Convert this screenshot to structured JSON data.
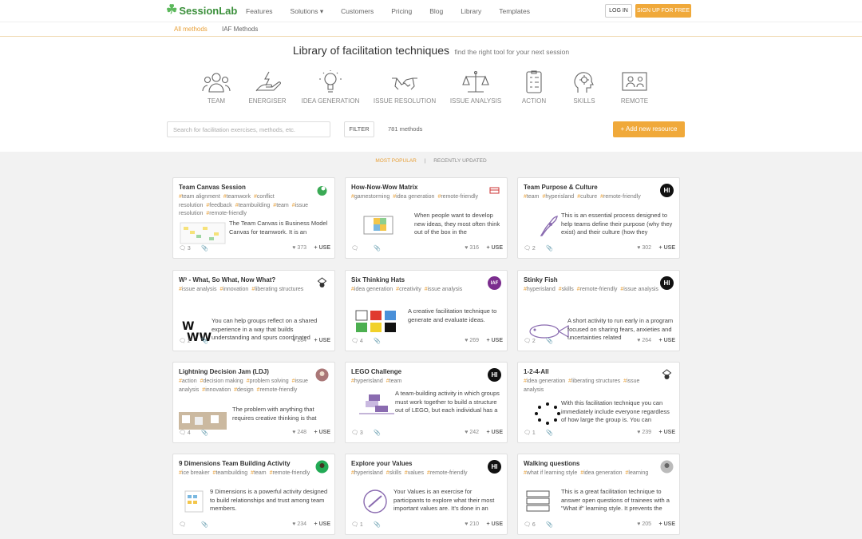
{
  "brand": {
    "name": "SessionLab",
    "accent": "#f0a93a",
    "tag_color": "#e8a13a"
  },
  "nav": {
    "items": [
      "Features",
      "Solutions ▾",
      "Customers",
      "Pricing",
      "Blog",
      "Library",
      "Templates"
    ],
    "login": "LOG IN",
    "signup": "SIGN UP FOR FREE"
  },
  "subnav": {
    "all": "All methods",
    "iaf": "IAF Methods"
  },
  "hero": {
    "title": "Library of facilitation techniques",
    "subtitle": "find the right tool for your next session"
  },
  "categories": [
    "TEAM",
    "ENERGISER",
    "IDEA GENERATION",
    "ISSUE RESOLUTION",
    "ISSUE ANALYSIS",
    "ACTION",
    "SKILLS",
    "REMOTE"
  ],
  "search": {
    "placeholder": "Search for facilitation exercises, methods, etc.",
    "filter": "FILTER",
    "count": "781 methods",
    "add": "+ Add new resource"
  },
  "sort": {
    "popular": "MOST POPULAR",
    "sep": "|",
    "recent": "RECENTLY UPDATED"
  },
  "cards": [
    {
      "title": "Team Canvas Session",
      "badge": "",
      "tags": [
        "team alignment",
        "teamwork",
        "conflict resolution",
        "feedback",
        "teambuilding",
        "team",
        "issue resolution",
        "remote-friendly"
      ],
      "desc": "The Team Canvas is Business Model Canvas for teamwork. It is an",
      "comments": "3",
      "likes": "373",
      "use": "USE"
    },
    {
      "title": "How-Now-Wow Matrix",
      "badge": "",
      "tags": [
        "gamestorming",
        "idea generation",
        "remote-friendly"
      ],
      "desc": "When people want to develop new ideas, they most often think out of the box in the",
      "comments": "",
      "likes": "316",
      "use": "USE"
    },
    {
      "title": "Team Purpose & Culture",
      "badge": "HI",
      "tags": [
        "team",
        "hyperisland",
        "culture",
        "remote-friendly"
      ],
      "desc": "This is an essential process designed to help teams define their purpose (why they exist) and their culture (how they",
      "comments": "2",
      "likes": "302",
      "use": "USE"
    },
    {
      "title": "W³ - What, So What, Now What?",
      "badge": "",
      "tags": [
        "issue analysis",
        "innovation",
        "liberating structures"
      ],
      "desc": "You can help groups reflect on a shared experience in a way that builds understanding and spurs coordinated",
      "comments": "2",
      "likes": "284",
      "use": "USE"
    },
    {
      "title": "Six Thinking Hats",
      "badge": "IAF",
      "tags": [
        "idea generation",
        "creativity",
        "issue analysis"
      ],
      "desc": "A creative facilitation technique to generate and evaluate ideas.",
      "comments": "4",
      "likes": "269",
      "use": "USE"
    },
    {
      "title": "Stinky Fish",
      "badge": "HI",
      "tags": [
        "hyperisland",
        "skills",
        "remote-friendly",
        "issue analysis"
      ],
      "desc": "A short activity to run early in a program focused on sharing fears, anxieties and uncertainties related",
      "comments": "2",
      "likes": "264",
      "use": "USE"
    },
    {
      "title": "Lightning Decision Jam (LDJ)",
      "badge": "",
      "tags": [
        "action",
        "decision making",
        "problem solving",
        "issue analysis",
        "innovation",
        "design",
        "remote-friendly"
      ],
      "desc": "The problem with anything that requires creative thinking is that",
      "comments": "4",
      "likes": "248",
      "use": "USE"
    },
    {
      "title": "LEGO Challenge",
      "badge": "HI",
      "tags": [
        "hyperisland",
        "team"
      ],
      "desc": "A team-building activity in which groups must work together to build a structure out of LEGO, but each individual has a secret \"assignment\"",
      "comments": "3",
      "likes": "242",
      "use": "USE"
    },
    {
      "title": "1-2-4-All",
      "badge": "",
      "tags": [
        "idea generation",
        "liberating structures",
        "issue analysis"
      ],
      "desc": "With this facilitation technique you can immediately include everyone regardless of how large the group is. You can",
      "comments": "1",
      "likes": "239",
      "use": "USE"
    },
    {
      "title": "9 Dimensions Team Building Activity",
      "badge": "",
      "tags": [
        "ice breaker",
        "teambuilding",
        "team",
        "remote-friendly"
      ],
      "desc": "9 Dimensions is a powerful activity designed to build relationships and trust among team members.",
      "comments": "",
      "likes": "234",
      "use": "USE"
    },
    {
      "title": "Explore your Values",
      "badge": "HI",
      "tags": [
        "hyperisland",
        "skills",
        "values",
        "remote-friendly"
      ],
      "desc": "Your Values is an exercise for participants to explore what their most important values are. It’s done in an",
      "comments": "1",
      "likes": "210",
      "use": "USE"
    },
    {
      "title": "Walking questions",
      "badge": "",
      "tags": [
        "what if learning style",
        "idea generation",
        "learning"
      ],
      "desc": "This is a great facilitation technique to answer open questions of trainees with a \"What if\" learning style. It prevents the",
      "comments": "6",
      "likes": "205",
      "use": "USE"
    }
  ]
}
